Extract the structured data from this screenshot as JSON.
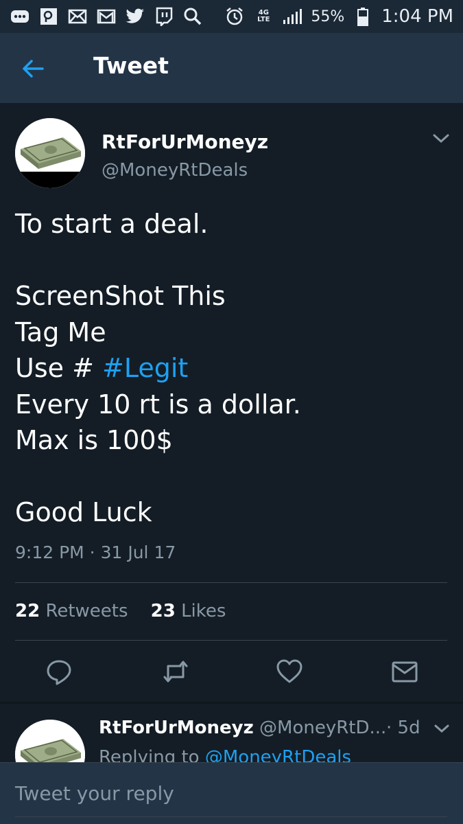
{
  "status_bar": {
    "battery_percent": "55%",
    "time": "1:04 PM",
    "network_label": "4G LTE",
    "icons": [
      "more-icon",
      "search-app-icon",
      "mail-icon",
      "gmail-icon",
      "twitter-icon",
      "twitch-icon",
      "search-icon",
      "alarm-icon",
      "network-icon",
      "signal-icon",
      "battery-icon"
    ]
  },
  "header": {
    "title": "Tweet"
  },
  "tweet": {
    "author_name": "RtForUrMoneyz",
    "author_handle": "@MoneyRtDeals",
    "text_lines": [
      "To start a deal.",
      "",
      "ScreenShot This",
      "Tag Me",
      "Use # ",
      "Every 10 rt is a dollar.",
      "Max is 100$",
      "",
      "Good Luck"
    ],
    "hashtag": "#Legit",
    "timestamp": "9:12 PM · 31 Jul 17",
    "retweets_count": "22",
    "retweets_label": "Retweets",
    "likes_count": "23",
    "likes_label": "Likes"
  },
  "reply_preview": {
    "author_name": "RtForUrMoneyz",
    "author_handle": "@MoneyRtD...",
    "time": "· 5d",
    "replying_prefix": "Replying to ",
    "replying_handle": "@MoneyRtDeals"
  },
  "compose": {
    "placeholder": "Tweet your reply"
  },
  "colors": {
    "background": "#141d26",
    "header": "#243447",
    "accent": "#1da1f2",
    "muted": "#8899a6"
  }
}
